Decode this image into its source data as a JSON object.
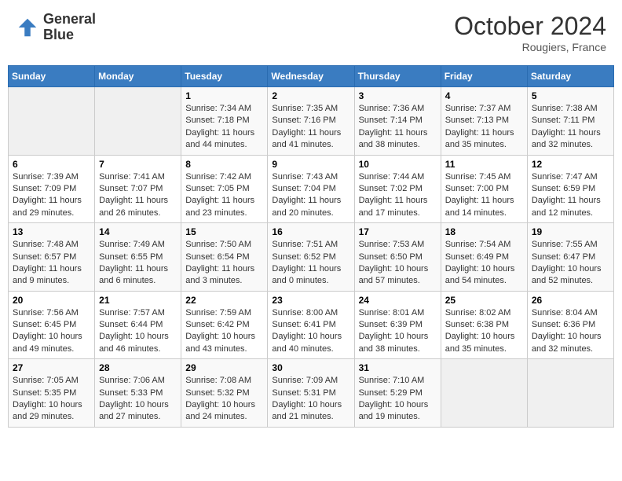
{
  "logo": {
    "line1": "General",
    "line2": "Blue"
  },
  "header": {
    "month": "October 2024",
    "location": "Rougiers, France"
  },
  "weekdays": [
    "Sunday",
    "Monday",
    "Tuesday",
    "Wednesday",
    "Thursday",
    "Friday",
    "Saturday"
  ],
  "weeks": [
    [
      {
        "day": "",
        "info": ""
      },
      {
        "day": "",
        "info": ""
      },
      {
        "day": "1",
        "info": "Sunrise: 7:34 AM\nSunset: 7:18 PM\nDaylight: 11 hours and 44 minutes."
      },
      {
        "day": "2",
        "info": "Sunrise: 7:35 AM\nSunset: 7:16 PM\nDaylight: 11 hours and 41 minutes."
      },
      {
        "day": "3",
        "info": "Sunrise: 7:36 AM\nSunset: 7:14 PM\nDaylight: 11 hours and 38 minutes."
      },
      {
        "day": "4",
        "info": "Sunrise: 7:37 AM\nSunset: 7:13 PM\nDaylight: 11 hours and 35 minutes."
      },
      {
        "day": "5",
        "info": "Sunrise: 7:38 AM\nSunset: 7:11 PM\nDaylight: 11 hours and 32 minutes."
      }
    ],
    [
      {
        "day": "6",
        "info": "Sunrise: 7:39 AM\nSunset: 7:09 PM\nDaylight: 11 hours and 29 minutes."
      },
      {
        "day": "7",
        "info": "Sunrise: 7:41 AM\nSunset: 7:07 PM\nDaylight: 11 hours and 26 minutes."
      },
      {
        "day": "8",
        "info": "Sunrise: 7:42 AM\nSunset: 7:05 PM\nDaylight: 11 hours and 23 minutes."
      },
      {
        "day": "9",
        "info": "Sunrise: 7:43 AM\nSunset: 7:04 PM\nDaylight: 11 hours and 20 minutes."
      },
      {
        "day": "10",
        "info": "Sunrise: 7:44 AM\nSunset: 7:02 PM\nDaylight: 11 hours and 17 minutes."
      },
      {
        "day": "11",
        "info": "Sunrise: 7:45 AM\nSunset: 7:00 PM\nDaylight: 11 hours and 14 minutes."
      },
      {
        "day": "12",
        "info": "Sunrise: 7:47 AM\nSunset: 6:59 PM\nDaylight: 11 hours and 12 minutes."
      }
    ],
    [
      {
        "day": "13",
        "info": "Sunrise: 7:48 AM\nSunset: 6:57 PM\nDaylight: 11 hours and 9 minutes."
      },
      {
        "day": "14",
        "info": "Sunrise: 7:49 AM\nSunset: 6:55 PM\nDaylight: 11 hours and 6 minutes."
      },
      {
        "day": "15",
        "info": "Sunrise: 7:50 AM\nSunset: 6:54 PM\nDaylight: 11 hours and 3 minutes."
      },
      {
        "day": "16",
        "info": "Sunrise: 7:51 AM\nSunset: 6:52 PM\nDaylight: 11 hours and 0 minutes."
      },
      {
        "day": "17",
        "info": "Sunrise: 7:53 AM\nSunset: 6:50 PM\nDaylight: 10 hours and 57 minutes."
      },
      {
        "day": "18",
        "info": "Sunrise: 7:54 AM\nSunset: 6:49 PM\nDaylight: 10 hours and 54 minutes."
      },
      {
        "day": "19",
        "info": "Sunrise: 7:55 AM\nSunset: 6:47 PM\nDaylight: 10 hours and 52 minutes."
      }
    ],
    [
      {
        "day": "20",
        "info": "Sunrise: 7:56 AM\nSunset: 6:45 PM\nDaylight: 10 hours and 49 minutes."
      },
      {
        "day": "21",
        "info": "Sunrise: 7:57 AM\nSunset: 6:44 PM\nDaylight: 10 hours and 46 minutes."
      },
      {
        "day": "22",
        "info": "Sunrise: 7:59 AM\nSunset: 6:42 PM\nDaylight: 10 hours and 43 minutes."
      },
      {
        "day": "23",
        "info": "Sunrise: 8:00 AM\nSunset: 6:41 PM\nDaylight: 10 hours and 40 minutes."
      },
      {
        "day": "24",
        "info": "Sunrise: 8:01 AM\nSunset: 6:39 PM\nDaylight: 10 hours and 38 minutes."
      },
      {
        "day": "25",
        "info": "Sunrise: 8:02 AM\nSunset: 6:38 PM\nDaylight: 10 hours and 35 minutes."
      },
      {
        "day": "26",
        "info": "Sunrise: 8:04 AM\nSunset: 6:36 PM\nDaylight: 10 hours and 32 minutes."
      }
    ],
    [
      {
        "day": "27",
        "info": "Sunrise: 7:05 AM\nSunset: 5:35 PM\nDaylight: 10 hours and 29 minutes."
      },
      {
        "day": "28",
        "info": "Sunrise: 7:06 AM\nSunset: 5:33 PM\nDaylight: 10 hours and 27 minutes."
      },
      {
        "day": "29",
        "info": "Sunrise: 7:08 AM\nSunset: 5:32 PM\nDaylight: 10 hours and 24 minutes."
      },
      {
        "day": "30",
        "info": "Sunrise: 7:09 AM\nSunset: 5:31 PM\nDaylight: 10 hours and 21 minutes."
      },
      {
        "day": "31",
        "info": "Sunrise: 7:10 AM\nSunset: 5:29 PM\nDaylight: 10 hours and 19 minutes."
      },
      {
        "day": "",
        "info": ""
      },
      {
        "day": "",
        "info": ""
      }
    ]
  ]
}
